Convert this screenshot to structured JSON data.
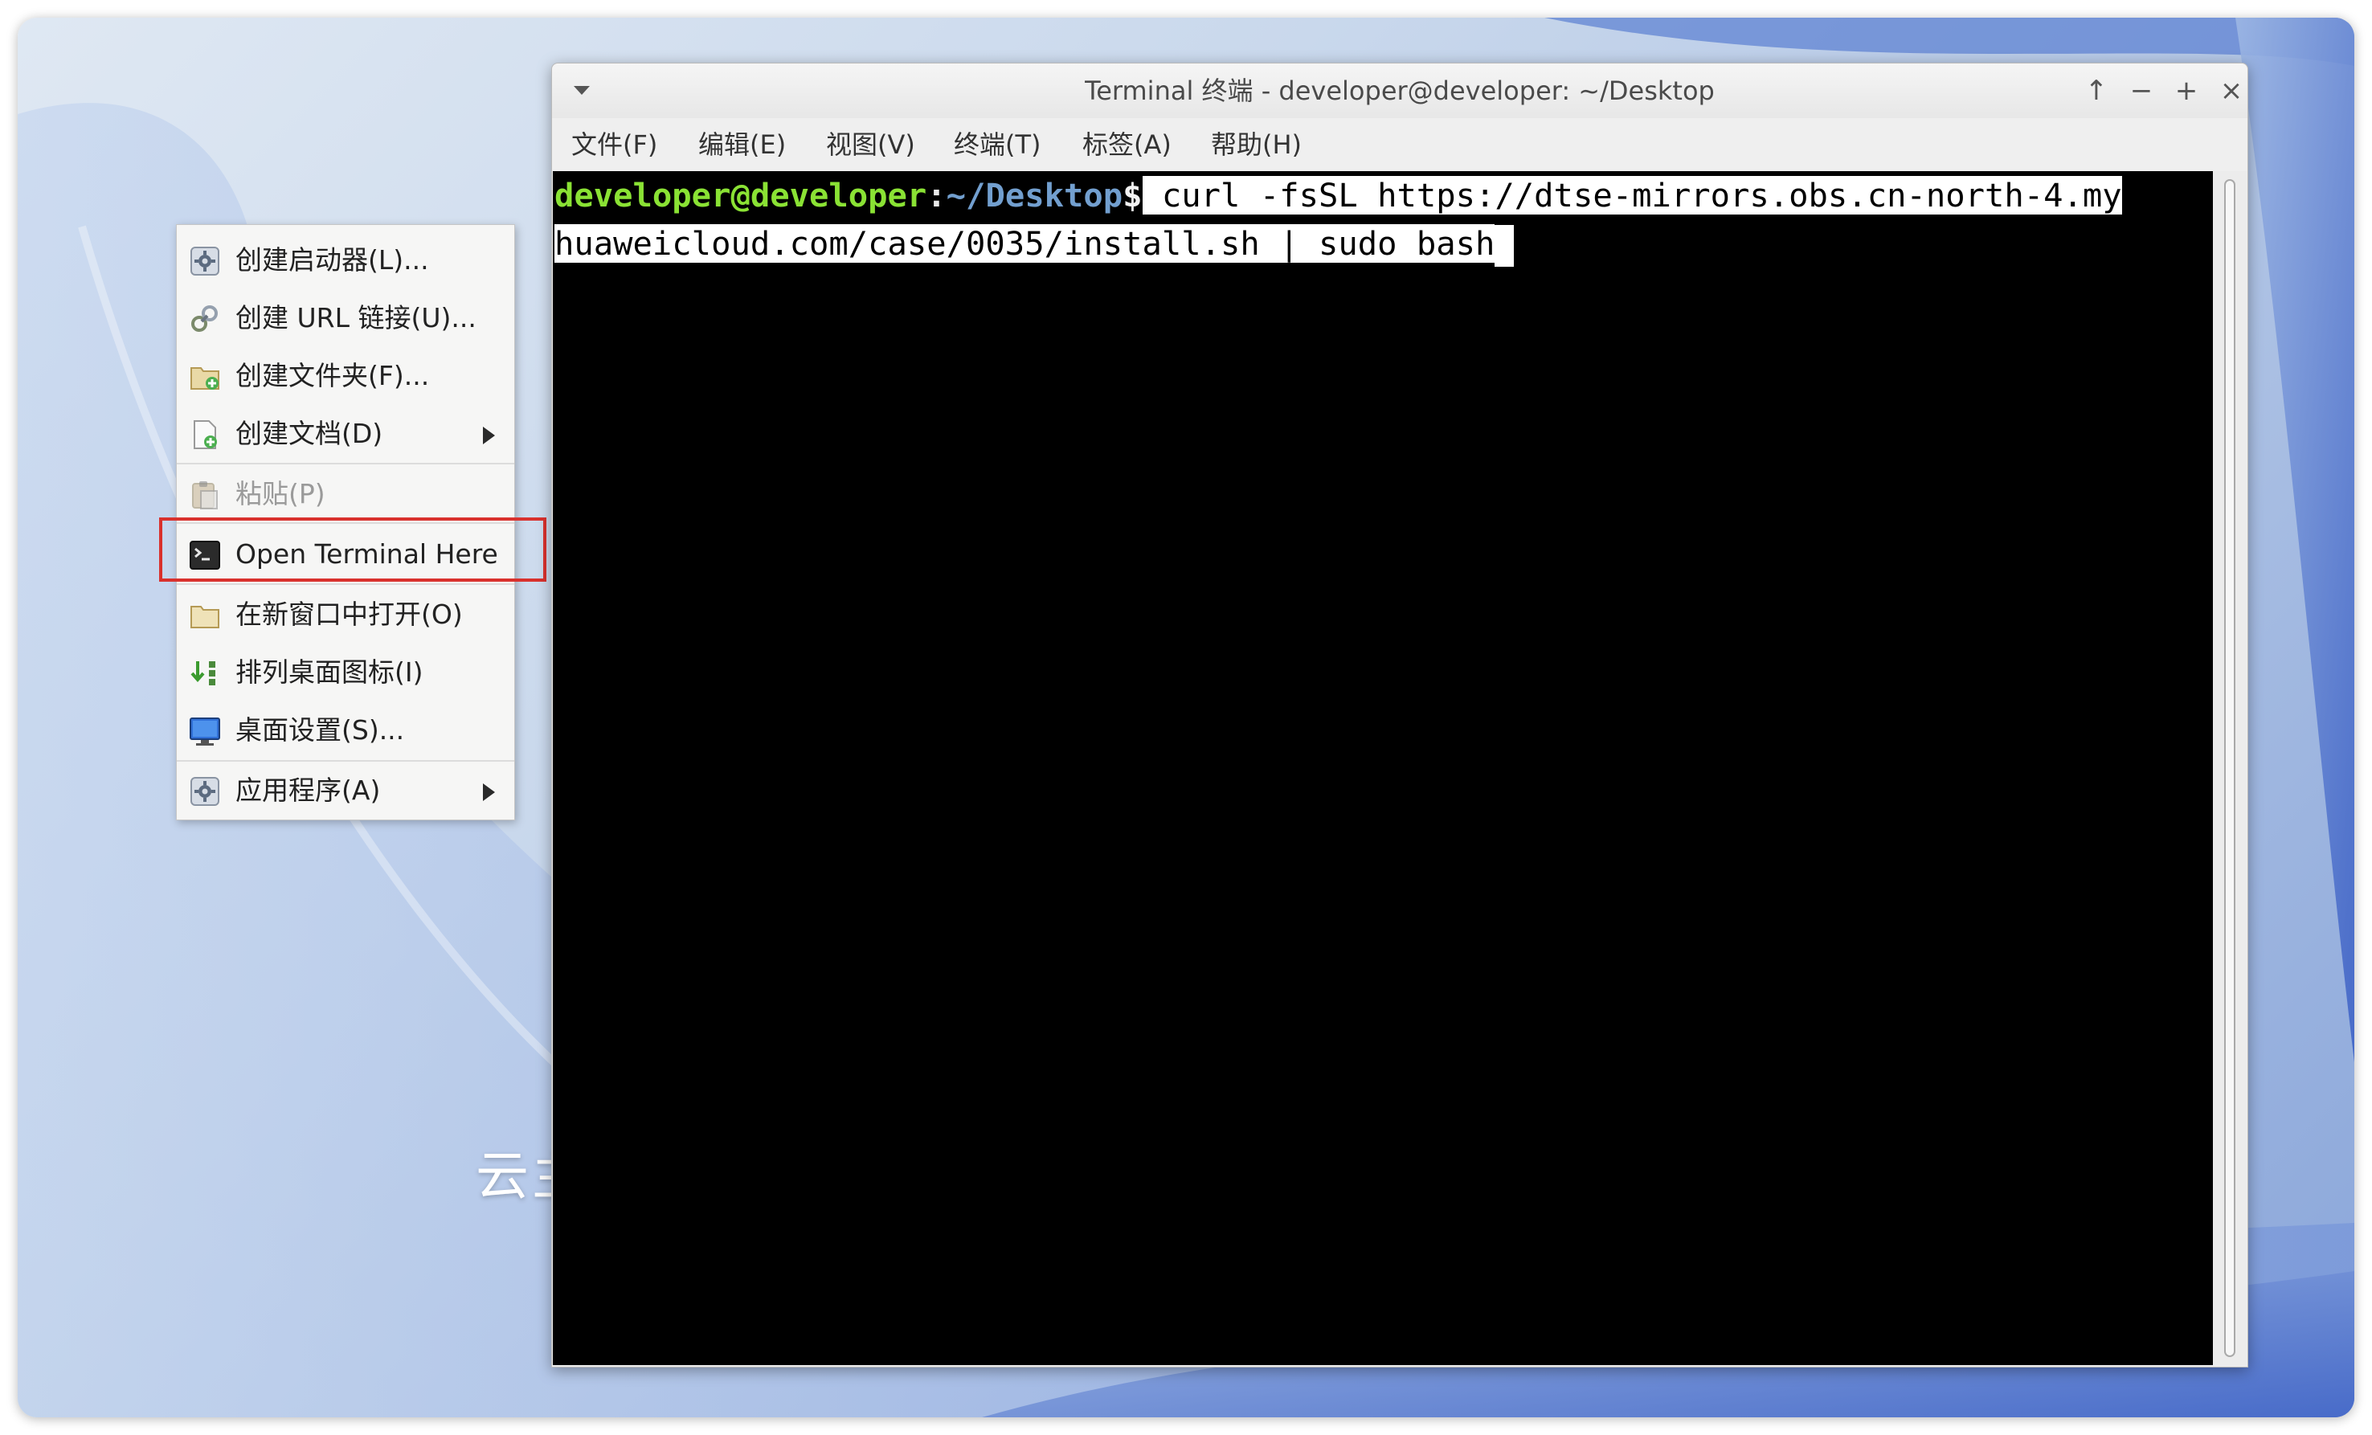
{
  "desktop": {
    "label": "云主"
  },
  "context_menu": {
    "items": [
      {
        "label": "创建启动器(L)...",
        "icon": "launcher-gear-icon",
        "disabled": false,
        "submenu": false
      },
      {
        "label": "创建 URL 链接(U)...",
        "icon": "link-icon",
        "disabled": false,
        "submenu": false
      },
      {
        "label": "创建文件夹(F)...",
        "icon": "new-folder-icon",
        "disabled": false,
        "submenu": false
      },
      {
        "label": "创建文档(D)",
        "icon": "new-document-icon",
        "disabled": false,
        "submenu": true
      },
      {
        "label": "粘贴(P)",
        "icon": "paste-icon",
        "disabled": true,
        "submenu": false
      },
      {
        "label": "Open Terminal Here",
        "icon": "terminal-icon",
        "disabled": false,
        "submenu": false,
        "highlighted": true
      },
      {
        "label": "在新窗口中打开(O)",
        "icon": "folder-icon",
        "disabled": false,
        "submenu": false
      },
      {
        "label": "排列桌面图标(I)",
        "icon": "arrange-icons-icon",
        "disabled": false,
        "submenu": false
      },
      {
        "label": "桌面设置(S)...",
        "icon": "desktop-settings-icon",
        "disabled": false,
        "submenu": false
      },
      {
        "label": "应用程序(A)",
        "icon": "applications-gear-icon",
        "disabled": false,
        "submenu": true
      }
    ],
    "highlight_color": "#d9312d"
  },
  "terminal": {
    "title": "Terminal 终端 - developer@developer: ~/Desktop",
    "titlebar_buttons": {
      "up": "↑",
      "minimize": "−",
      "maximize": "+",
      "close": "×"
    },
    "menu": [
      "文件(F)",
      "编辑(E)",
      "视图(V)",
      "终端(T)",
      "标签(A)",
      "帮助(H)"
    ],
    "prompt": {
      "user_host": "developer@developer",
      "colon": ":",
      "path": "~/Desktop",
      "dollar": "$"
    },
    "command_line1": " curl -fsSL https://dtse-mirrors.obs.cn-north-4.my",
    "command_line2": "huaweicloud.com/case/0035/install.sh | sudo bash",
    "colors": {
      "background": "#000000",
      "user": "#8ae234",
      "path": "#729fcf",
      "text": "#f2f2f2"
    }
  }
}
